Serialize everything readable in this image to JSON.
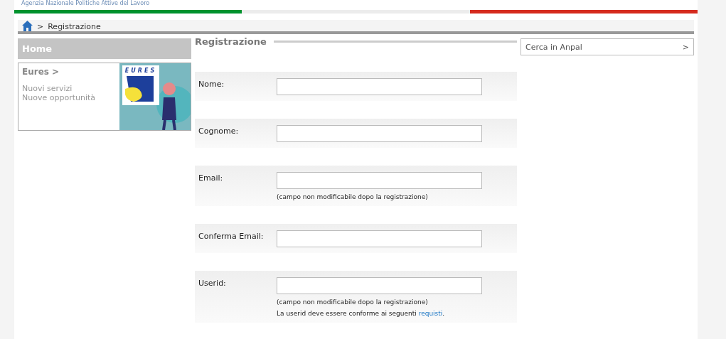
{
  "header": {
    "agency": "Agenzia Nazionale Politiche Attive del Lavoro"
  },
  "breadcrumb": {
    "separator": ">",
    "current": "Registrazione"
  },
  "sidebar": {
    "title": "Home",
    "promo": {
      "title": "Eures >",
      "lines": [
        "Nuovi servizi",
        "Nuove opportunità"
      ],
      "logo_text": "EURES"
    }
  },
  "form": {
    "title": "Registrazione",
    "fields": [
      {
        "label": "Nome:"
      },
      {
        "label": "Cognome:"
      },
      {
        "label": "Email:",
        "notes": [
          {
            "text": "(campo non modificabile dopo la registrazione)"
          }
        ]
      },
      {
        "label": "Conferma Email:"
      },
      {
        "label": "Userid:",
        "notes": [
          {
            "text": "(campo non modificabile dopo la registrazione)"
          },
          {
            "text": "La userid deve essere conforme ai seguenti",
            "link": "requisti",
            "after": "."
          }
        ]
      }
    ]
  },
  "search": {
    "label": "Cerca in Anpal",
    "arrow": ">"
  }
}
